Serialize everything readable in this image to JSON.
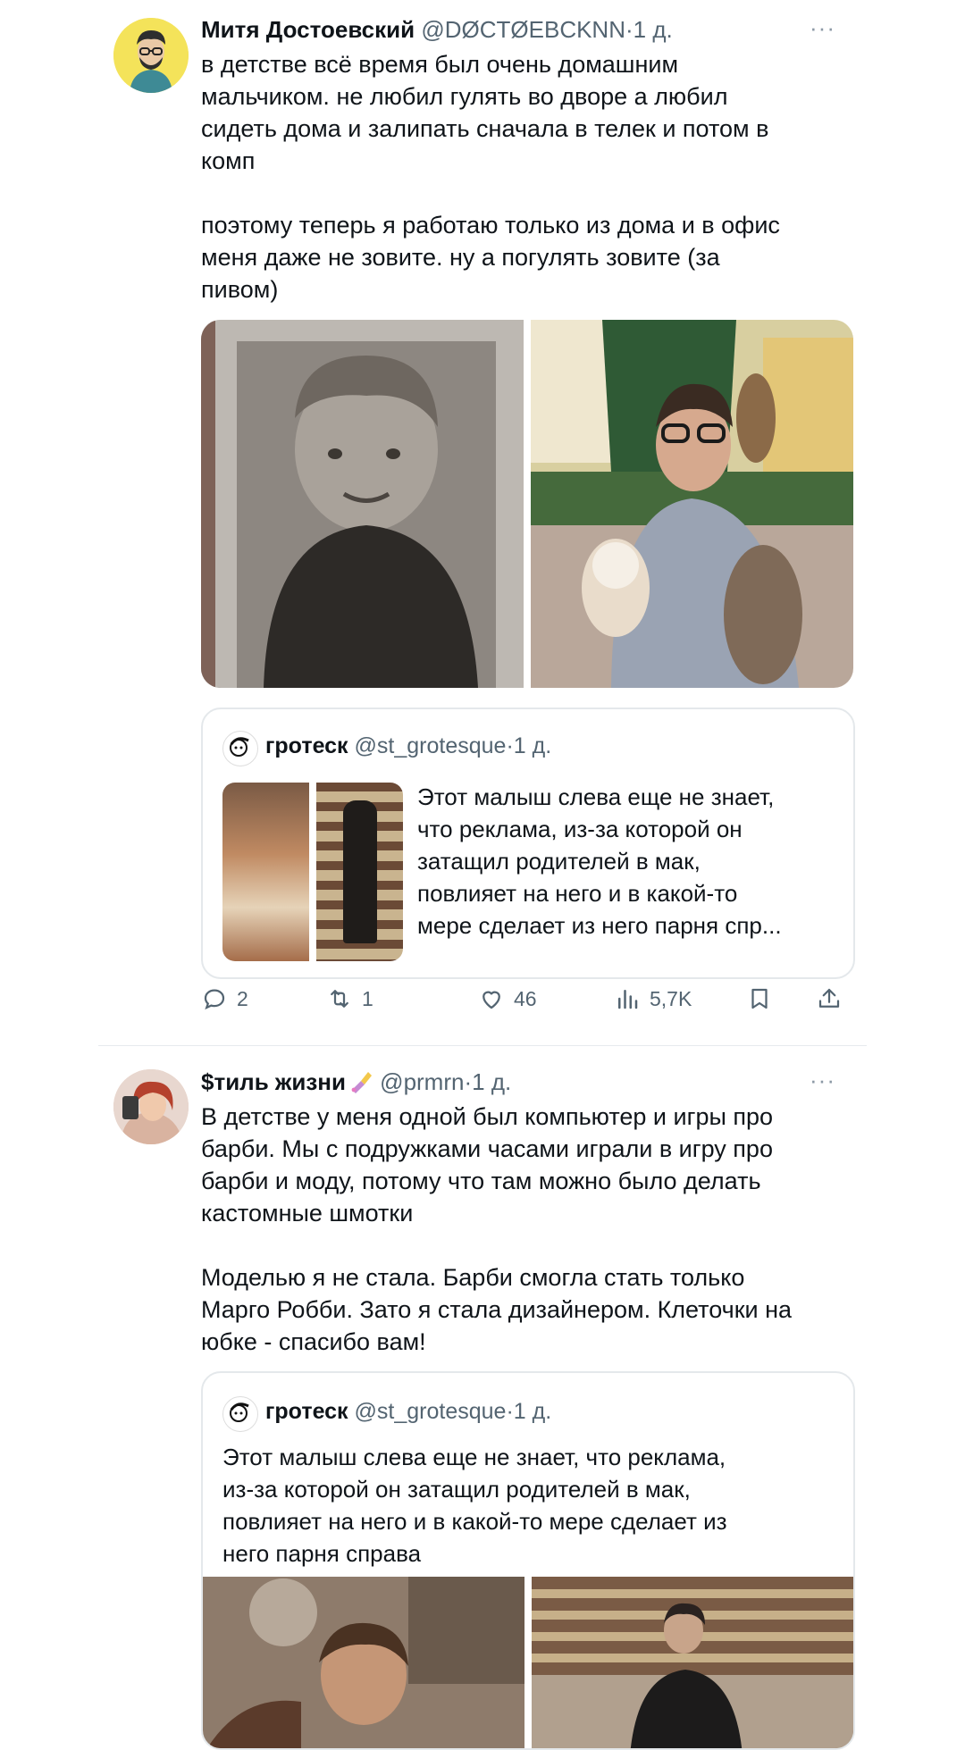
{
  "tweets": [
    {
      "author_name": "Митя Достоевский",
      "handle": "@DØCTØEBCKNN",
      "separator": "·",
      "time": "1 д.",
      "more": "···",
      "text": "в детстве всё время был очень домашним\nмальчиком. не любил гулять во дворе а любил\nсидеть дома и залипать сначала в телек и потом в\nкомп\n\nпоэтому теперь я работаю только из дома и в офис\nменя даже не зовите. ну а погулять зовите (за\nпивом)",
      "quote": {
        "author_name": "гротеск",
        "handle": "@st_grotesque",
        "separator": "·",
        "time": "1 д.",
        "text": "Этот малыш слева  еще не знает,\nчто реклама, из-за которой он\nзатащил родителей в мак,\nповлияет на него и в какой-то\nмере сделает из него парня спр..."
      },
      "actions": {
        "replies": "2",
        "retweets": "1",
        "likes": "46",
        "views": "5,7K"
      }
    },
    {
      "author_name": "$тиль жизни",
      "handle": "@prmrn",
      "separator": "·",
      "time": "1 д.",
      "more": "···",
      "text": "В детстве у меня одной был компьютер и игры про\nбарби. Мы с подружками часами играли в игру про\nбарби и моду, потому что там можно было делать\nкастомные шмотки\n\nМоделью я не стала. Барби смогла стать только\nМарго Робби. Зато я стала дизайнером. Клеточки на\nюбке - спасибо вам!",
      "quote": {
        "author_name": "гротеск",
        "handle": "@st_grotesque",
        "separator": "·",
        "time": "1 д.",
        "text": "Этот малыш слева  еще не знает, что реклама,\nиз-за которой он затащил родителей в мак,\nповлияет на него и в какой-то мере сделает из\nнего парня справа"
      }
    }
  ],
  "icons": {
    "reply": "reply-icon",
    "retweet": "retweet-icon",
    "like": "heart-icon",
    "views": "analytics-icon",
    "bookmark": "bookmark-icon",
    "share": "share-icon",
    "emoji": "nail-polish-emoji"
  },
  "colors": {
    "text": "#0f1419",
    "secondary": "#536471",
    "border": "#e4e8eb"
  }
}
